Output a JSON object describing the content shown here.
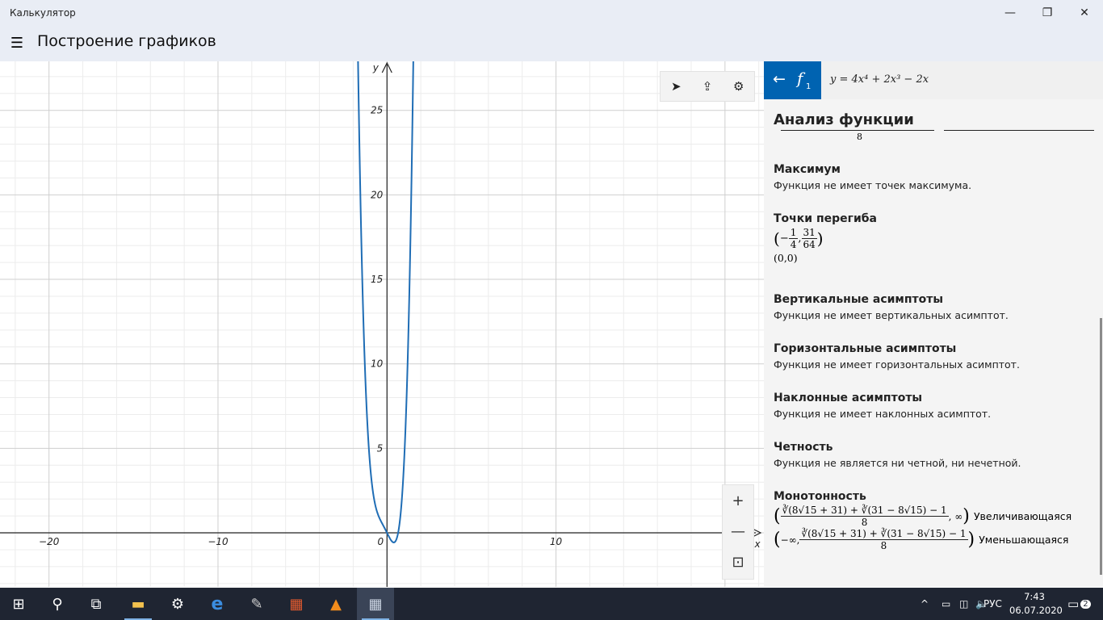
{
  "window": {
    "title": "Калькулятор",
    "minimize_glyph": "—",
    "maximize_glyph": "❐",
    "close_glyph": "✕"
  },
  "header": {
    "menu_glyph": "☰",
    "title": "Построение графиков"
  },
  "graph": {
    "y_axis_label": "y",
    "x_axis_label": "x",
    "x_tick_labels": [
      "−20",
      "−10",
      "0",
      "10"
    ],
    "y_tick_labels": [
      "5",
      "10",
      "15",
      "20",
      "25"
    ],
    "toolbar": {
      "select_icon": "➤",
      "share_icon": "⇪",
      "settings_icon": "⚙"
    },
    "zoom": {
      "in": "+",
      "out": "—",
      "reset": "⊡"
    },
    "curve_color": "#1f6db5"
  },
  "chart_data": {
    "type": "line",
    "function": "y = 4x^4 + 2x^3 - 2x",
    "xlim": [
      -22.9,
      22.3
    ],
    "ylim": [
      -3.2,
      27.9
    ],
    "x_ticks": [
      -20,
      -10,
      0,
      10
    ],
    "y_ticks": [
      5,
      10,
      15,
      20,
      25
    ],
    "grid": true,
    "series": [
      {
        "expression": "4*x^4 + 2*x^3 - 2*x",
        "color": "#1f6db5"
      }
    ]
  },
  "panel": {
    "back_glyph": "←",
    "func_letter": "f",
    "func_index": "1",
    "formula": "y = 4x⁴ + 2x³ − 2x",
    "title": "Анализ функции",
    "clipped_denominator": "8",
    "max": {
      "heading": "Максимум",
      "text": "Функция не имеет точек максимума."
    },
    "inflection": {
      "heading": "Точки перегиба",
      "p1_sign": "−",
      "p1_x_num": "1",
      "p1_x_den": "4",
      "p1_y_num": "31",
      "p1_y_den": "64",
      "p2": "(0,0)"
    },
    "vertical": {
      "heading": "Вертикальные асимптоты",
      "text": "Функция не имеет вертикальных асимптот."
    },
    "horizontal": {
      "heading": "Горизонтальные асимптоты",
      "text": "Функция не имеет горизонтальных асимптот."
    },
    "oblique": {
      "heading": "Наклонные асимптоты",
      "text": "Функция не имеет наклонных асимптот."
    },
    "parity": {
      "heading": "Четность",
      "text": "Функция не является ни четной, ни нечетной."
    },
    "monotony": {
      "heading": "Монотонность",
      "interval_num": "∛(8√15 + 31) + ∛(31 − 8√15) − 1",
      "interval_den": "8",
      "inc_tail": ", ∞",
      "inc_label": "Увеличивающаяся",
      "dec_head": "−∞,",
      "dec_label": "Уменьшающаяся"
    }
  },
  "taskbar": {
    "start_icon": "⊞",
    "search_icon": "⚲",
    "taskview_icon": "⧉",
    "explorer_icon": "▬",
    "settings_icon": "⚙",
    "edge_icon": "e",
    "pen_icon": "✎",
    "app_icon": "▦",
    "vlc_icon": "▲",
    "calc_icon": "▦",
    "tray_up": "^",
    "battery_icon": "▭",
    "network_icon": "◫",
    "volume_icon": "🔈",
    "language": "РУС",
    "time": "7:43",
    "date": "06.07.2020",
    "notifications_count": "2"
  }
}
